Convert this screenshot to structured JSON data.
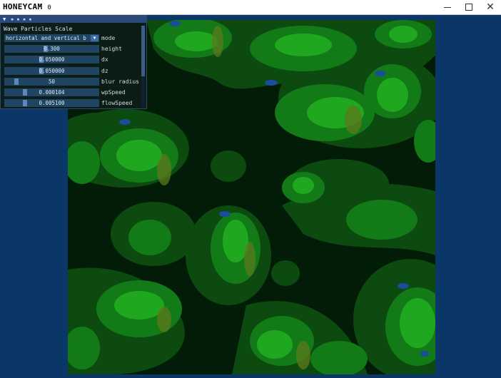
{
  "window": {
    "title": "HONEYCAM",
    "title_suffix": "0",
    "minimize_label": "",
    "maximize_label": "",
    "close_label": "✕"
  },
  "panel": {
    "title": "▪ ▪ ▪ ▪",
    "section_title": "Wave Particles Scale",
    "controls": [
      {
        "type": "combo",
        "value": "horizontal and vertical b",
        "label": "mode"
      },
      {
        "type": "slider",
        "value": "0.300",
        "label": "height",
        "fraction": 0.43
      },
      {
        "type": "slider",
        "value": "0.050000",
        "label": "dx",
        "fraction": 0.38
      },
      {
        "type": "slider",
        "value": "0.050000",
        "label": "dz",
        "fraction": 0.38
      },
      {
        "type": "slider",
        "value": "50",
        "label": "blur radius",
        "fraction": 0.1
      },
      {
        "type": "slider",
        "value": "0.000104",
        "label": "wpSpeed",
        "fraction": 0.2
      },
      {
        "type": "slider",
        "value": "0.005100",
        "label": "flowSpeed",
        "fraction": 0.2
      }
    ],
    "scroll_fraction": 0.62
  },
  "colors": {
    "background": "#0b3768",
    "water_deep": "#031c08",
    "water_mid": "#0d4a10",
    "water_light": "#1a8a1a",
    "water_peak": "#22b022",
    "foam": "#1a4d9a"
  }
}
